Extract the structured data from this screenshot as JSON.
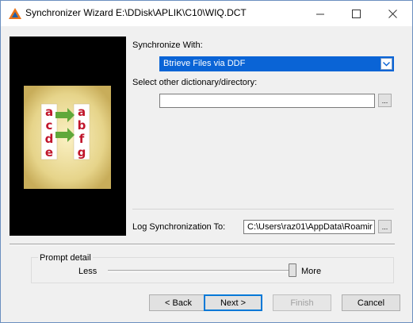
{
  "window": {
    "title": "Synchronizer Wizard E:\\DDisk\\APLIK\\C10\\WIQ.DCT",
    "minimize_icon": "minimize-icon",
    "maximize_icon": "maximize-icon",
    "close_icon": "close-icon"
  },
  "form": {
    "sync_with_label": "Synchronize With:",
    "sync_with_value": "Btrieve Files via DDF",
    "other_dir_label": "Select other dictionary/directory:",
    "other_dir_value": "",
    "browse_dir_label": "...",
    "log_label": "Log Synchronization To:",
    "log_value": "C:\\Users\\raz01\\AppData\\Roamir",
    "browse_log_label": "..."
  },
  "prompt_detail": {
    "group_label": "Prompt detail",
    "less_label": "Less",
    "more_label": "More",
    "level": 1.0
  },
  "buttons": {
    "back": "< Back",
    "next": "Next >",
    "finish": "Finish",
    "cancel": "Cancel"
  },
  "picture": {
    "left_letters": [
      "a",
      "c",
      "d",
      "e"
    ],
    "right_letters": [
      "a",
      "b",
      "f",
      "g"
    ]
  },
  "colors": {
    "accent": "#0078d7",
    "selection": "#0a64d6",
    "letter_red": "#c0152a",
    "arrow_green": "#5fa83a"
  }
}
